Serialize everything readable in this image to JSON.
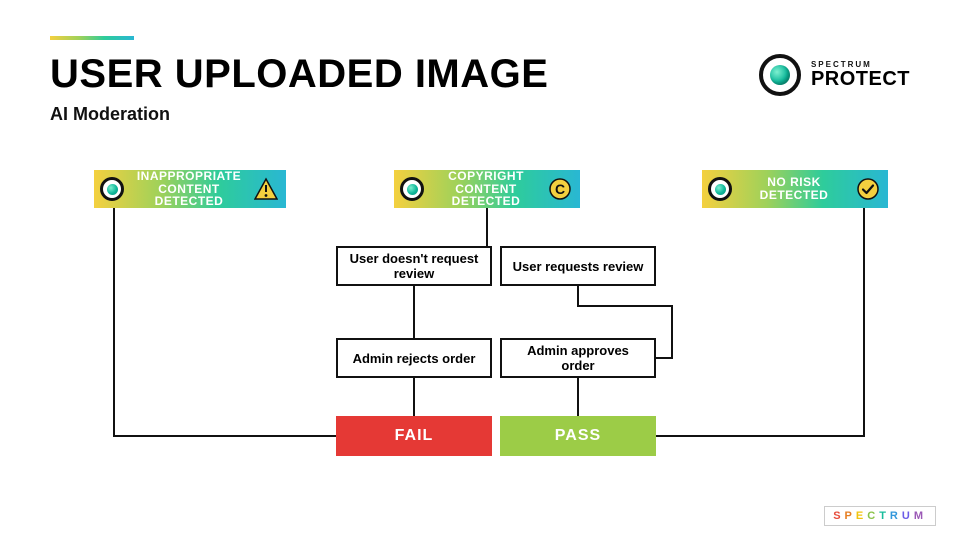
{
  "header": {
    "title": "USER UPLOADED IMAGE",
    "subtitle": "AI Moderation"
  },
  "brand": {
    "kicker": "SPECTRUM",
    "word": "PROTECT"
  },
  "banners": {
    "inappropriate": "INAPPROPRIATE CONTENT DETECTED",
    "copyright": "COPYRIGHT CONTENT DETECTED",
    "norisk": "NO RISK DETECTED"
  },
  "decisions": {
    "no_review": "User doesn't request review",
    "req_review": "User requests review",
    "admin_reject": "Admin rejects order",
    "admin_approve": "Admin approves order"
  },
  "results": {
    "fail": "FAIL",
    "pass": "PASS"
  },
  "footer": {
    "logo": "SPECTRUM"
  },
  "colors": {
    "fail": "#e53935",
    "pass": "#9ccc47",
    "gradient": [
      "#f4d03f",
      "#9ed15a",
      "#2ecc9b",
      "#29b7d3"
    ]
  }
}
